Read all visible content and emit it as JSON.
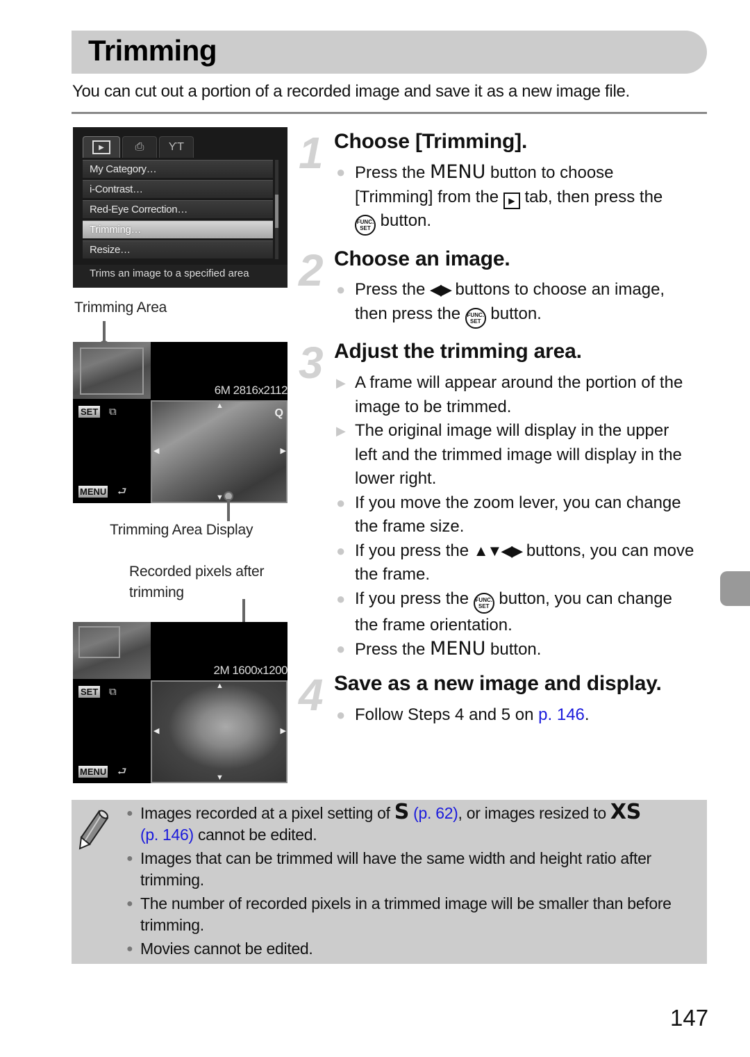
{
  "header": {
    "title": "Trimming",
    "intro": "You can cut out a portion of a recorded image and save it as a new image file."
  },
  "menu_screen": {
    "tabs": [
      {
        "name": "playback",
        "glyph": "▶"
      },
      {
        "name": "print",
        "glyph": "⎙"
      },
      {
        "name": "settings",
        "glyph": "ƳT"
      }
    ],
    "items": [
      "My Category…",
      "i-Contrast…",
      "Red-Eye Correction…",
      "Trimming…",
      "Resize…"
    ],
    "selected_index": 3,
    "help_text": "Trims an image to a specified area"
  },
  "trim_screen_1": {
    "pixel_readout": "6M 2816x2112",
    "set_label": "SET",
    "menu_label": "MENU",
    "zoom_glyph": "Q"
  },
  "trim_screen_2": {
    "pixel_readout": "2M 1600x1200",
    "set_label": "SET",
    "menu_label": "MENU"
  },
  "callouts": {
    "trimming_area": "Trimming Area",
    "trimming_area_display": "Trimming Area Display",
    "recorded_pixels_line1": "Recorded pixels after",
    "recorded_pixels_line2": "trimming"
  },
  "steps": [
    {
      "number": "1",
      "title": "Choose [Trimming].",
      "bullets": [
        {
          "t1": "Press the ",
          "menu": "MENU",
          "t2": " button to choose [Trimming] from the ",
          "play": "▶",
          "t3": " tab, then press the ",
          "func": "FUNC. SET",
          "t4": " button."
        }
      ]
    },
    {
      "number": "2",
      "title": "Choose an image.",
      "bullets": [
        {
          "t1": "Press the ",
          "arrows": "◀▶",
          "t2": " buttons to choose an image, then press the ",
          "func": "FUNC. SET",
          "t3": " button."
        }
      ]
    },
    {
      "number": "3",
      "title": "Adjust the trimming area.",
      "bullets": [
        {
          "type": "result",
          "text": "A frame will appear around the portion of the image to be trimmed."
        },
        {
          "type": "result",
          "text": "The original image will display in the upper left and the trimmed image will display in the lower right."
        },
        {
          "type": "action",
          "text": "If you move the zoom lever, you can change the frame size."
        },
        {
          "type": "action",
          "t1": "If you press the ",
          "arrows": "▲▼◀▶",
          "t2": " buttons, you can move the frame."
        },
        {
          "type": "action",
          "t1": "If you press the ",
          "func": "FUNC. SET",
          "t2": " button, you can change the frame orientation."
        },
        {
          "type": "action",
          "t1": "Press the ",
          "menu": "MENU",
          "t2": " button."
        }
      ]
    },
    {
      "number": "4",
      "title": "Save as a new image and display.",
      "bullets": [
        {
          "t1": "Follow Steps 4 and 5 on ",
          "link": "p. 146",
          "t2": "."
        }
      ]
    }
  ],
  "note": {
    "icon": "pencil-icon",
    "items": [
      {
        "t1": "Images recorded at a pixel setting of ",
        "s_glyph": "S",
        "link1": "(p. 62)",
        "t2": ", or images resized to ",
        "xs_glyph": "XS",
        "link2": "(p. 146)",
        "t3": " cannot be edited."
      },
      {
        "text": "Images that can be trimmed will have the same width and height ratio after trimming."
      },
      {
        "text": "The number of recorded pixels in a trimmed image will be smaller than before trimming."
      },
      {
        "text": "Movies cannot be edited."
      }
    ]
  },
  "page_number": "147",
  "colors": {
    "link": "#1a1adc",
    "title_bar": "#cccccc",
    "step_number": "#d2d2d2",
    "side_tab": "#999999"
  }
}
